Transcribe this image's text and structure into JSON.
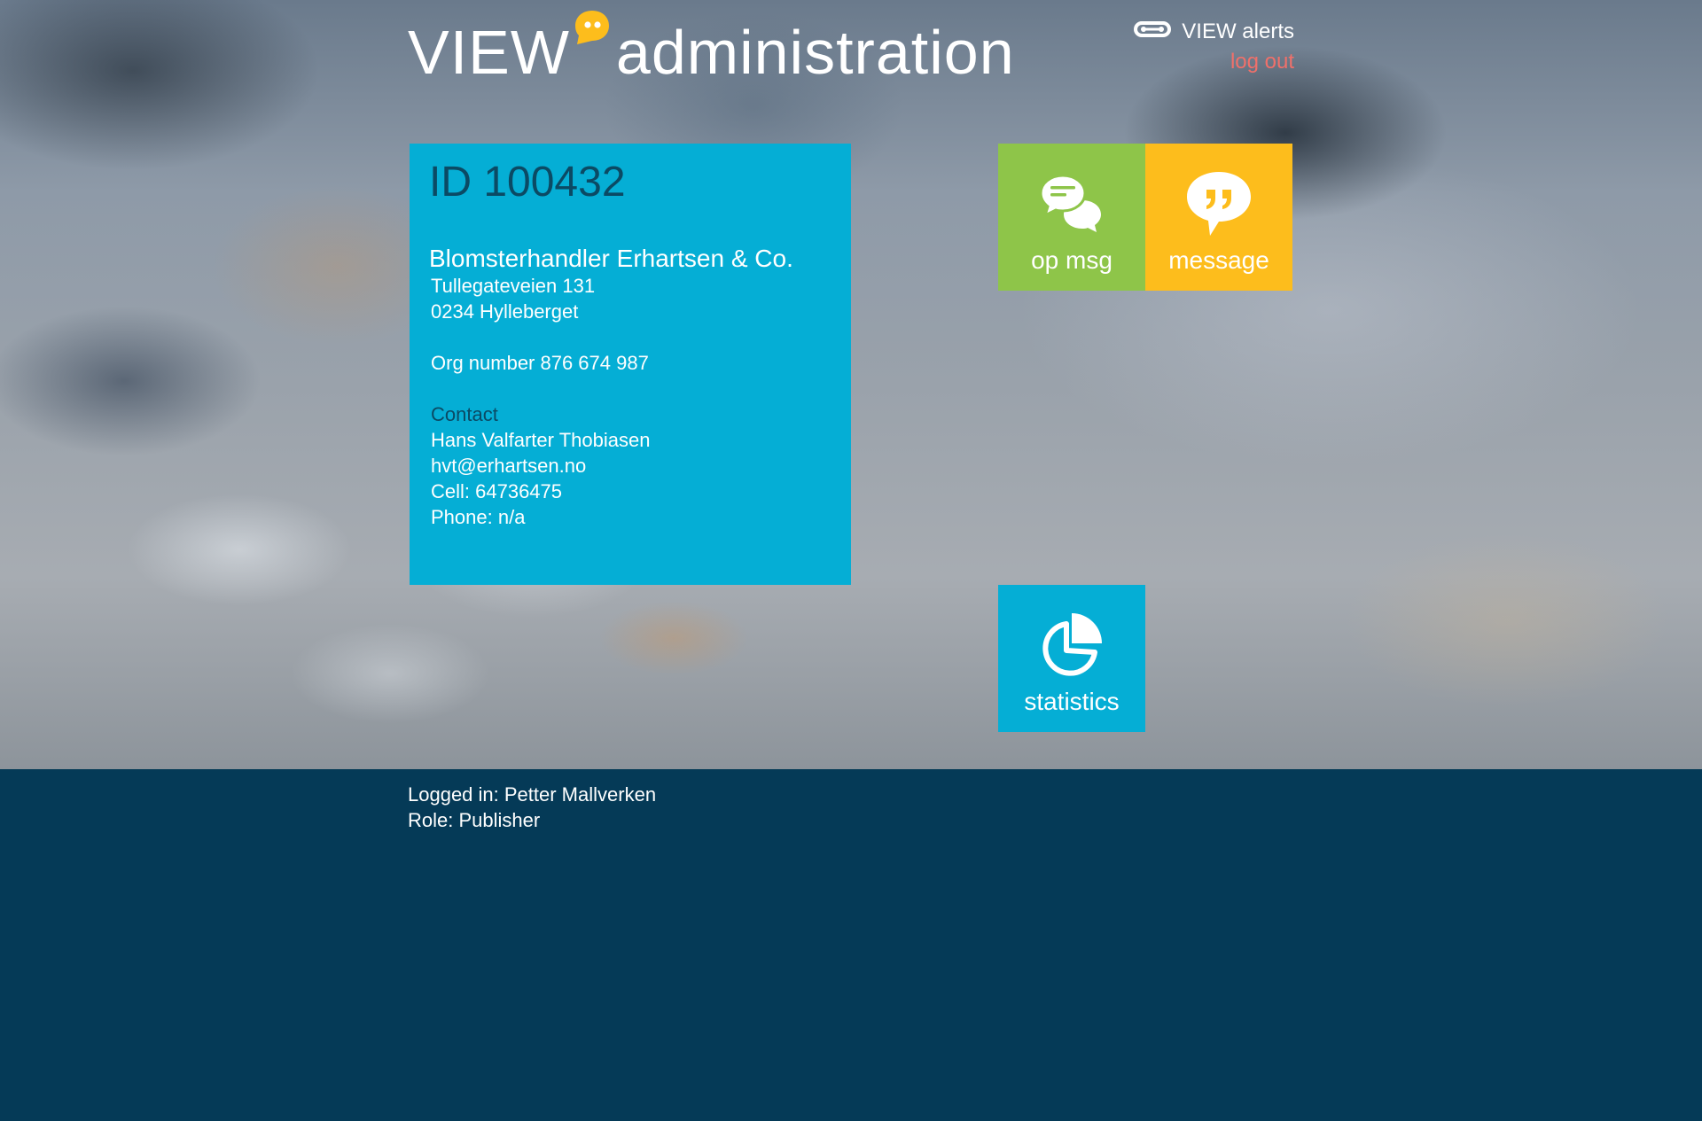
{
  "header": {
    "logo_view": "VIEW",
    "logo_admin": "administration",
    "alerts_label": "VIEW alerts",
    "logout_label": "log out"
  },
  "card": {
    "id": "ID 100432",
    "company": "Blomsterhandler Erhartsen & Co.",
    "street": "Tullegateveien 131",
    "postal": "0234 Hylleberget",
    "org_number": "Org number 876 674 987",
    "contact_label": "Contact",
    "contact_name": "Hans Valfarter Thobiasen",
    "contact_email": "hvt@erhartsen.no",
    "contact_cell": "Cell: 64736475",
    "contact_phone": "Phone: n/a"
  },
  "tiles": {
    "op_msg": "op msg",
    "message": "message",
    "statistics": "statistics"
  },
  "footer": {
    "logged_in": "Logged in: Petter Mallverken",
    "role": "Role: Publisher"
  },
  "colors": {
    "accent_blue": "#05aed5",
    "accent_green": "#8ec549",
    "accent_yellow": "#fdbd1c",
    "logout_red": "#f0706a",
    "footer_bg": "#053a57"
  }
}
